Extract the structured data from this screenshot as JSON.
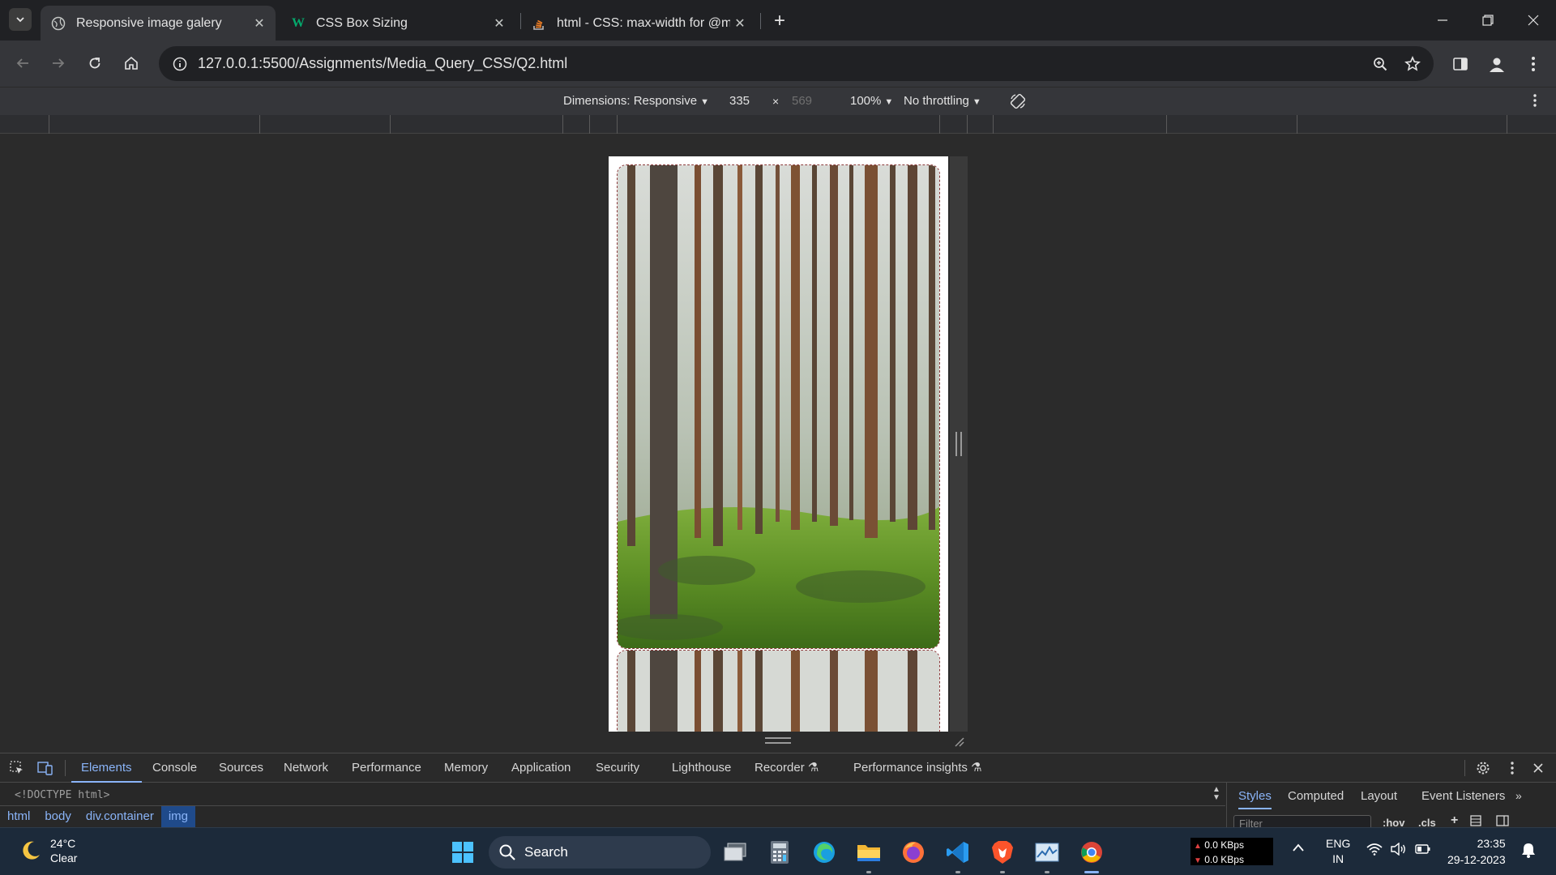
{
  "browser": {
    "tabs": [
      {
        "title": "Responsive image galery",
        "active": true,
        "favicon": "globe-icon"
      },
      {
        "title": "CSS Box Sizing",
        "active": false,
        "favicon": "w3schools-icon"
      },
      {
        "title": "html - CSS: max-width for @me",
        "active": false,
        "favicon": "stackoverflow-icon"
      }
    ],
    "url": "127.0.0.1:5500/Assignments/Media_Query_CSS/Q2.html"
  },
  "device_toolbar": {
    "dimensions_label": "Dimensions: Responsive",
    "width": "335",
    "times": "×",
    "height": "569",
    "zoom": "100%",
    "throttling": "No throttling"
  },
  "viewport": {
    "images": [
      {
        "alt": "pine forest photo"
      },
      {
        "alt": "pine forest photo"
      }
    ]
  },
  "devtools": {
    "tabs": [
      "Elements",
      "Console",
      "Sources",
      "Network",
      "Performance",
      "Memory",
      "Application",
      "Security",
      "Lighthouse",
      "Recorder",
      "Performance insights"
    ],
    "active_tab": "Elements",
    "doctype": "<!DOCTYPE html>",
    "breadcrumbs": [
      "html",
      "body",
      "div.container",
      "img"
    ],
    "side_tabs": [
      "Styles",
      "Computed",
      "Layout",
      "Event Listeners"
    ],
    "filter_placeholder": "Filter",
    "hov": ":hov",
    "cls": ".cls"
  },
  "taskbar": {
    "temperature": "24°C",
    "condition": "Clear",
    "search": "Search",
    "net_up": "0.0 KBps",
    "net_down": "0.0 KBps",
    "lang": "ENG",
    "region": "IN",
    "time": "23:35",
    "date": "29-12-2023"
  },
  "colors": {
    "accent": "#8ab4f8",
    "tab_active_bg": "#35363a",
    "chrome_bg": "#202124"
  }
}
